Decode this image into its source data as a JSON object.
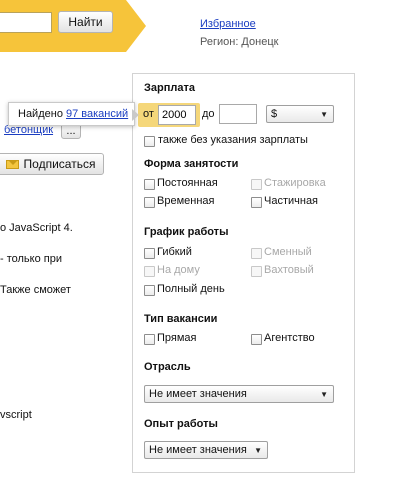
{
  "header": {
    "search_value": "",
    "find_button": "Найти",
    "favorites_link": "Избранное",
    "region_text": "Регион: Донецк"
  },
  "left": {
    "link_fragment": "бетонщик",
    "more_button": "...",
    "subscribe_button": "Подписаться",
    "line1": "о JavaScript 4.",
    "line2": "- только при",
    "line3": "Также сможет",
    "line4": "vscript"
  },
  "tooltip": {
    "prefix": "Найдено",
    "link": "97 вакансий"
  },
  "filters": {
    "salary": {
      "title": "Зарплата",
      "from_label": "от",
      "from_value": "2000",
      "to_label": "до",
      "to_value": "",
      "currency": "$",
      "no_salary_label": "также без указания зарплаты"
    },
    "employment": {
      "title": "Форма занятости",
      "permanent": "Постоянная",
      "internship": "Стажировка",
      "temporary": "Временная",
      "partial": "Частичная"
    },
    "schedule": {
      "title": "График работы",
      "flexible": "Гибкий",
      "shift": "Сменный",
      "remote": "На дому",
      "rotation": "Вахтовый",
      "fullday": "Полный день"
    },
    "vacancy_type": {
      "title": "Тип вакансии",
      "direct": "Прямая",
      "agency": "Агентство"
    },
    "industry": {
      "title": "Отрасль",
      "selected": "Не имеет значения"
    },
    "experience": {
      "title": "Опыт работы",
      "selected": "Не имеет значения"
    }
  },
  "colors": {
    "accent_yellow": "#f6c43a",
    "link_blue": "#1a3dc1"
  }
}
